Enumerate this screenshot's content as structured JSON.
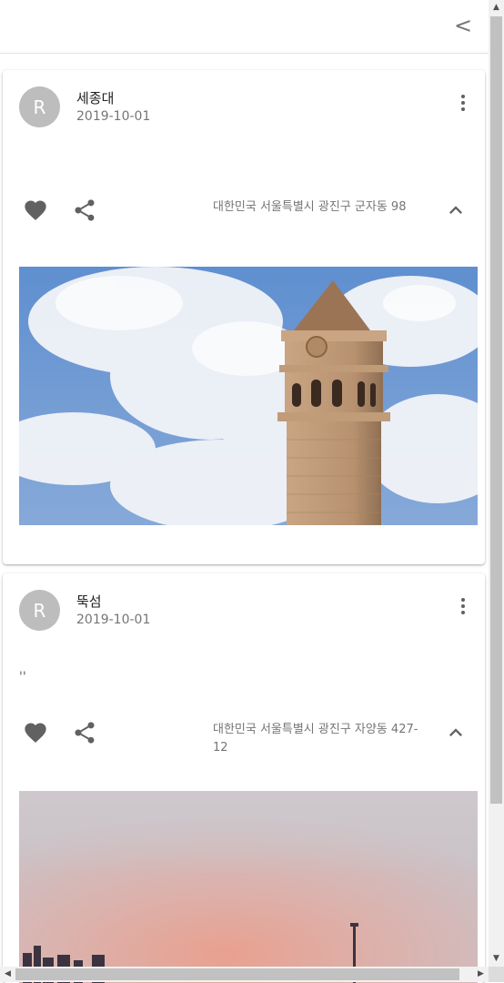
{
  "appbar": {
    "back_label": "<"
  },
  "posts": [
    {
      "avatar_letter": "R",
      "title": "세종대",
      "date": "2019-10-01",
      "body": "",
      "location": "대한민국 서울특별시 광진구 군자동 98"
    },
    {
      "avatar_letter": "R",
      "title": "뚝섬",
      "date": "2019-10-01",
      "body": "''",
      "location": "대한민국 서울특별시 광진구 자양동 427-12"
    }
  ],
  "icons": {
    "favorite": "heart-icon",
    "share": "share-icon",
    "more": "more-vert-icon",
    "expand": "chevron-up-icon"
  },
  "colors": {
    "icon": "#616161",
    "avatar": "#bdbdbd"
  }
}
